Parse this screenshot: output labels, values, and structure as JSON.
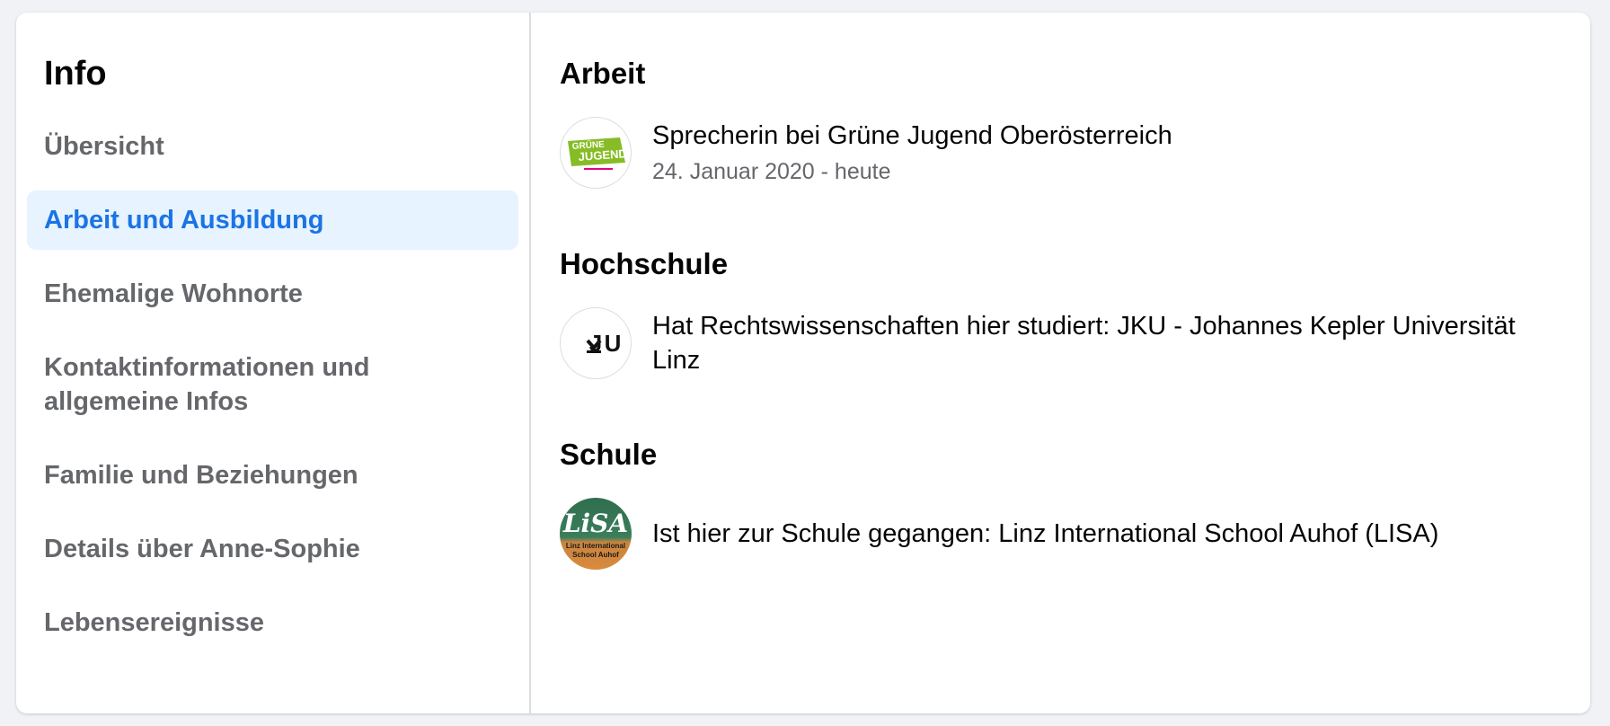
{
  "sidebar": {
    "title": "Info",
    "items": [
      {
        "label": "Übersicht",
        "active": false
      },
      {
        "label": "Arbeit und Ausbildung",
        "active": true
      },
      {
        "label": "Ehemalige Wohnorte",
        "active": false
      },
      {
        "label": "Kontaktinformationen und allgemeine Infos",
        "active": false
      },
      {
        "label": "Familie und Beziehungen",
        "active": false
      },
      {
        "label": "Details über Anne-Sophie",
        "active": false
      },
      {
        "label": "Lebensereignisse",
        "active": false
      }
    ]
  },
  "main": {
    "work": {
      "title": "Arbeit",
      "entry_text": "Sprecherin bei Grüne Jugend Oberösterreich",
      "entry_date": "24. Januar 2020 - heute",
      "logo_icon": "gruene-jugend-logo-icon",
      "logo_text": "GRÜNE JUGEND OBERÖSTERREICH"
    },
    "university": {
      "title": "Hochschule",
      "entry_text": "Hat Rechtswissenschaften hier studiert: JKU - Johannes Kepler Universität Linz",
      "logo_icon": "jku-logo-icon",
      "logo_text": "JKU"
    },
    "school": {
      "title": "Schule",
      "entry_text": "Ist hier zur Schule gegangen: Linz International School Auhof (LISA)",
      "logo_icon": "lisa-logo-icon",
      "logo_text": "LISA Linz International School Auhof"
    }
  },
  "colors": {
    "active_bg": "#e7f3ff",
    "active_text": "#1b74e4",
    "muted_text": "#65676b",
    "page_bg": "#f0f2f5"
  }
}
